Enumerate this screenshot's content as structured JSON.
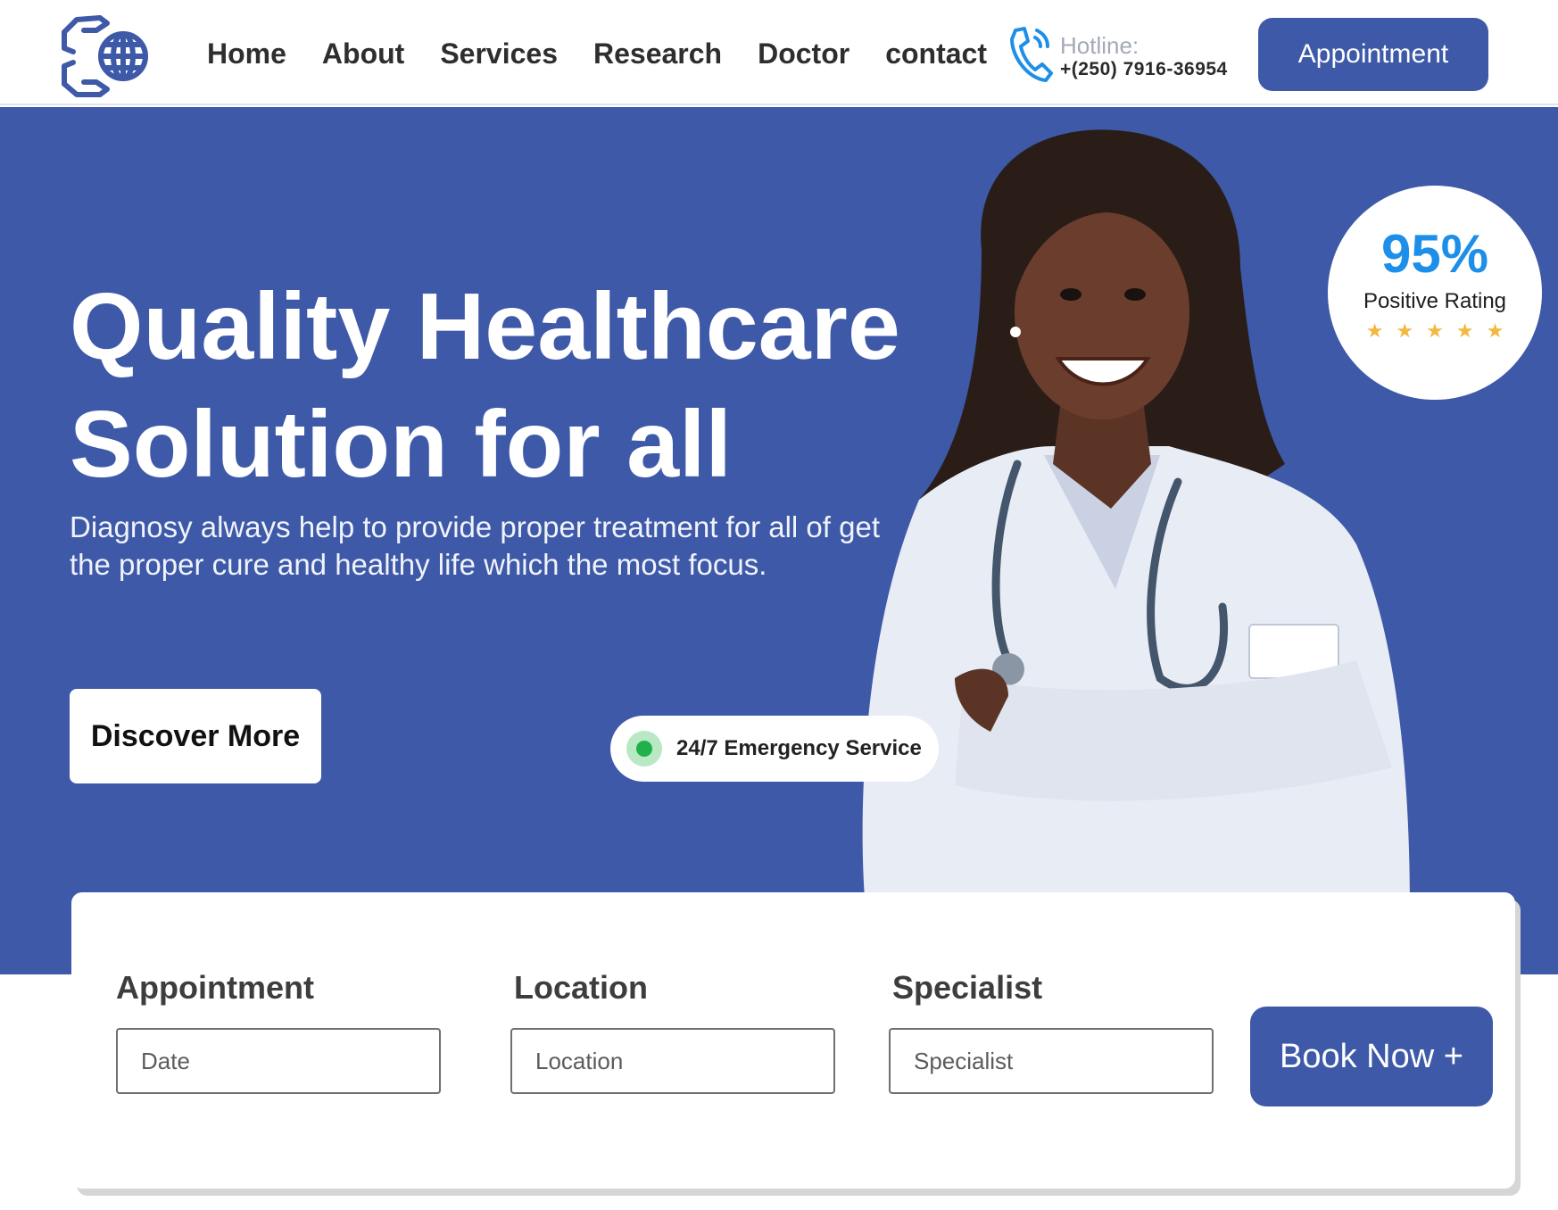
{
  "header": {
    "nav": [
      "Home",
      "About",
      "Services",
      "Research",
      "Doctor",
      "contact"
    ],
    "hotline_label": "Hotline:",
    "hotline_number": "+(250) 7916-36954",
    "appointment_label": "Appointment"
  },
  "hero": {
    "title_line1": "Quality Healthcare",
    "title_line2": "Solution for all",
    "description": "Diagnosy always help to provide proper treatment for all of get the proper cure and healthy life which the most focus.",
    "discover_label": "Discover More",
    "emergency_label": "24/7  Emergency Service",
    "rating": {
      "value": "95%",
      "label": "Positive Rating",
      "stars": 5,
      "stars_text": "★★★★★"
    }
  },
  "booking": {
    "appointment_label": "Appointment",
    "appointment_placeholder": "Date",
    "location_label": "Location",
    "location_placeholder": "Location",
    "specialist_label": "Specialist",
    "specialist_placeholder": "Specialist",
    "book_label": "Book Now +"
  },
  "colors": {
    "primary": "#3d59a8",
    "rating_blue": "#1e8fe8",
    "star": "#f4b740",
    "status_green": "#1fb14a"
  },
  "icons": [
    "logo-hands-globe-icon",
    "phone-icon",
    "star-icon",
    "status-dot-icon"
  ]
}
